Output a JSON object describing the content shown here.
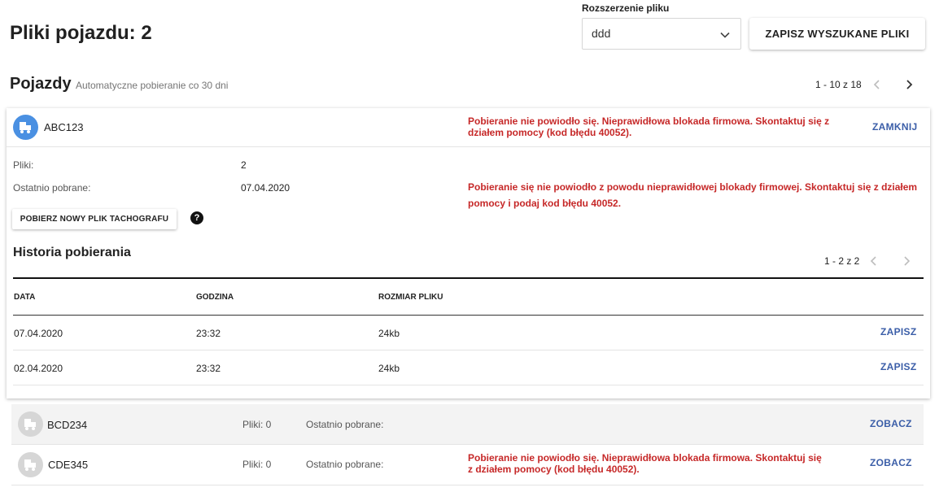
{
  "header": {
    "title": "Pliki pojazdu: 2",
    "extension_label": "Rozszerzenie pliku",
    "extension_value": "ddd",
    "save_found_button": "ZAPISZ WYSZUKANE PLIKI"
  },
  "section": {
    "title": "Pojazdy",
    "subtitle": "Automatyczne pobieranie co 30 dni",
    "pager": "1 - 10 z 18"
  },
  "expanded_vehicle": {
    "plate": "ABC123",
    "error_line1": "Pobieranie nie powiodło się. Nieprawidłowa blokada firmowa. Skontaktuj się z",
    "error_line2": "działem pomocy (kod błędu 40052).",
    "close_button": "ZAMKNIJ",
    "files_label": "Pliki:",
    "files_value": "2",
    "last_label": "Ostatnio pobrane:",
    "last_value": "07.04.2020",
    "detail_error_line1": "Pobieranie się nie powiodło z powodu nieprawidłowej blokady firmowej. Skontaktuj się z działem",
    "detail_error_line2": "pomocy i podaj kod błędu 40052.",
    "download_button": "POBIERZ NOWY PLIK TACHOGRAFU",
    "help_icon": "?",
    "history": {
      "title": "Historia pobierania",
      "pager": "1 - 2 z 2",
      "columns": [
        "DATA",
        "GODZINA",
        "ROZMIAR PLIKU"
      ],
      "rows": [
        {
          "date": "07.04.2020",
          "time": "23:32",
          "size": "24kb",
          "action": "ZAPISZ"
        },
        {
          "date": "02.04.2020",
          "time": "23:32",
          "size": "24kb",
          "action": "ZAPISZ"
        }
      ]
    }
  },
  "vehicles": [
    {
      "plate": "BCD234",
      "files": "Pliki: 0",
      "last": "Ostatnio pobrane:",
      "error_line1": "",
      "error_line2": "",
      "action": "ZOBACZ"
    },
    {
      "plate": "CDE345",
      "files": "Pliki: 0",
      "last": "Ostatnio pobrane:",
      "error_line1": "Pobieranie nie powiodło się. Nieprawidłowa blokada firmowa. Skontaktuj się",
      "error_line2": "z działem pomocy (kod błędu 40052).",
      "action": "ZOBACZ"
    }
  ],
  "colors": {
    "accent_link": "#3b5ea8",
    "error": "#c62828",
    "vehicle_icon_active": "#4a90e2",
    "vehicle_icon_inactive": "#d6d6d6"
  },
  "icons": {
    "vehicle": "truck-icon",
    "dropdown": "chevron-down-icon",
    "prev": "chevron-left-icon",
    "next": "chevron-right-icon",
    "help": "help-icon"
  }
}
